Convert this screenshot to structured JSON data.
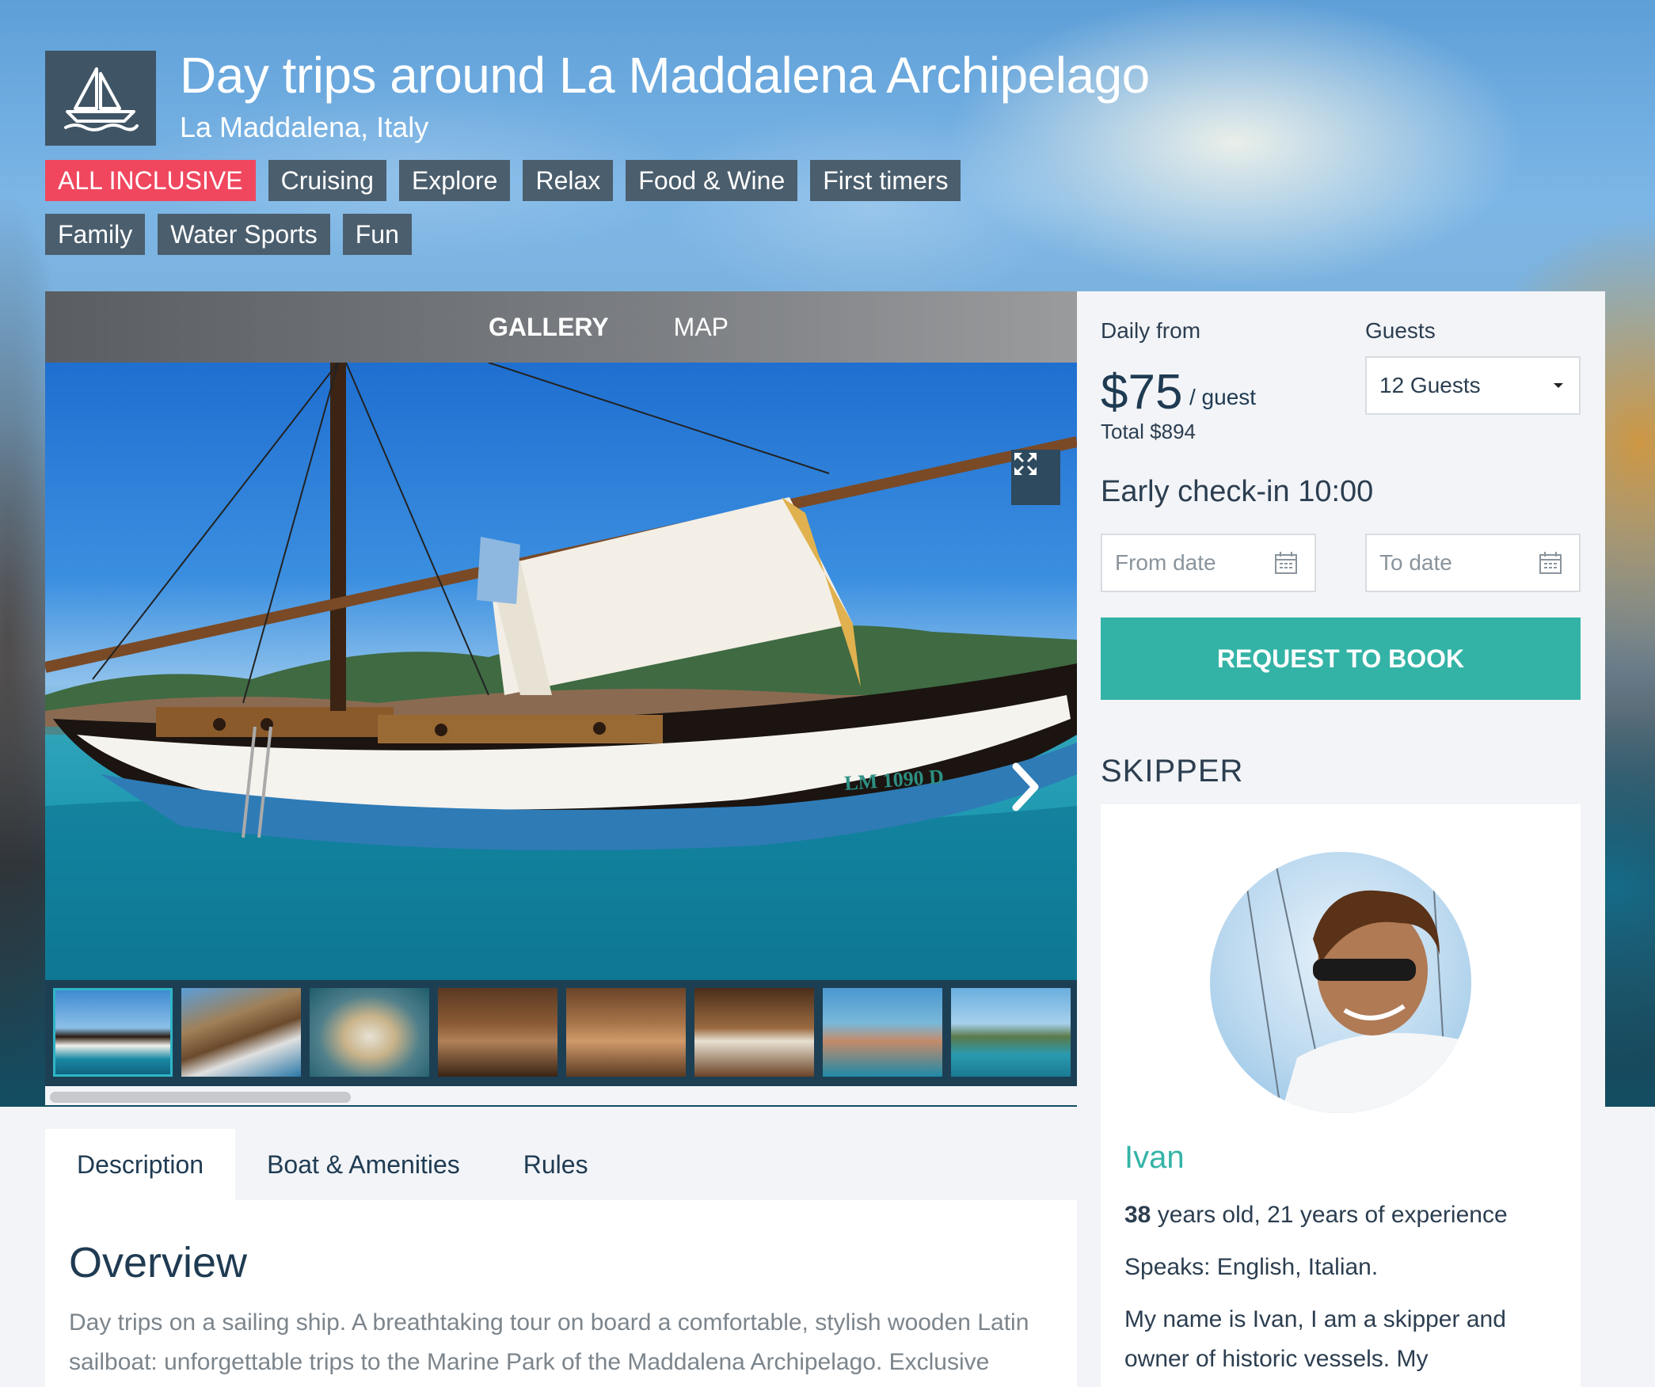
{
  "header": {
    "title": "Day trips around La Maddalena Archipelago",
    "location": "La Maddalena, Italy",
    "logo_icon": "sailboat-icon",
    "tags": [
      {
        "label": "ALL INCLUSIVE",
        "highlight": true
      },
      {
        "label": "Cruising",
        "highlight": false
      },
      {
        "label": "Explore",
        "highlight": false
      },
      {
        "label": "Relax",
        "highlight": false
      },
      {
        "label": "Food & Wine",
        "highlight": false
      },
      {
        "label": "First timers",
        "highlight": false
      },
      {
        "label": "Family",
        "highlight": false
      },
      {
        "label": "Water Sports",
        "highlight": false
      },
      {
        "label": "Fun",
        "highlight": false
      }
    ]
  },
  "gallery": {
    "tabs": [
      "GALLERY",
      "MAP"
    ],
    "active_tab": "GALLERY",
    "boat_registration": "LM 1090 D",
    "expand_icon": "expand-arrows-icon",
    "next_icon": "chevron-right-icon",
    "thumbnail_count": 8,
    "active_thumbnail": 0
  },
  "booking": {
    "daily_from_label": "Daily from",
    "price": "$75",
    "per_unit": "/ guest",
    "total": "Total $894",
    "guests_label": "Guests",
    "guests_selected": "12 Guests",
    "checkin": "Early check-in 10:00",
    "from_date_placeholder": "From date",
    "to_date_placeholder": "To date",
    "book_button": "REQUEST TO BOOK",
    "accent_color": "#33b3a6"
  },
  "skipper": {
    "heading": "SKIPPER",
    "name": "Ivan",
    "age": "38",
    "experience_text": "years old, 21 years of experience",
    "languages": "Speaks: English, Italian.",
    "bio_line1": "My name is Ivan, I am a skipper and",
    "bio_line2": "owner of historic vessels. My"
  },
  "content": {
    "tabs": [
      "Description",
      "Boat & Amenities",
      "Rules"
    ],
    "active_tab": "Description",
    "overview_heading": "Overview",
    "overview_line1": "Day trips on a sailing ship. A breathtaking tour on board a comfortable, stylish wooden Latin",
    "overview_line2": "sailboat: unforgettable trips to the Marine Park of the Maddalena Archipelago. Exclusive"
  },
  "colors": {
    "tag_bg": "#4b5e6d",
    "tag_highlight": "#f0475f",
    "navy": "#1f3b52"
  }
}
